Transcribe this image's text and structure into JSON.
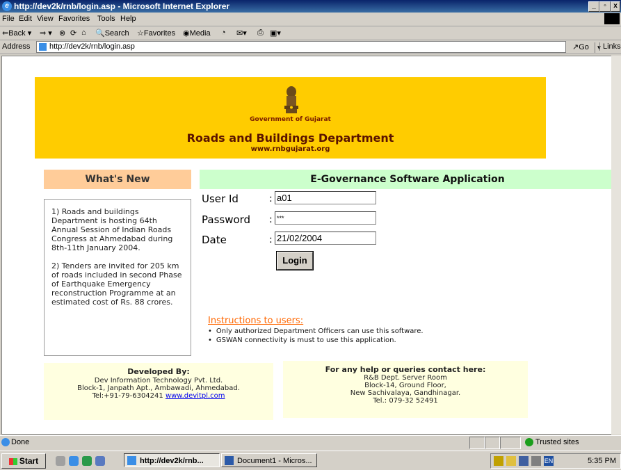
{
  "window": {
    "title": "http://dev2k/rnb/login.asp - Microsoft Internet Explorer"
  },
  "menu": [
    "File",
    "Edit",
    "View",
    "Favorites",
    "Tools",
    "Help"
  ],
  "toolbar": {
    "back": "⇐Back ▾",
    "forward": "⇒ ▾",
    "search": "Search",
    "favorites": "Favorites",
    "media": "Media"
  },
  "address": {
    "label": "Address",
    "url": "http://dev2k/rnb/login.asp",
    "go": "Go",
    "links": "Links"
  },
  "banner": {
    "gov": "Government of Gujarat",
    "dept": "Roads and Buildings Department",
    "www": "www.rnbgujarat.org"
  },
  "whats_new": {
    "heading": "What's New",
    "items": [
      "1) Roads and buildings Department is hosting 64th Annual Session of Indian Roads Congress at Ahmedabad during 8th-11th January 2004.",
      "2) Tenders are invited for 205 km of roads included in second Phase of Earthquake Emergency reconstruction Programme at an estimated cost of Rs. 88 crores."
    ]
  },
  "egov": {
    "heading": "E-Governance Software Application",
    "user_label": "User Id",
    "user_value": "a01",
    "password_label": "Password",
    "password_value": "***",
    "date_label": "Date",
    "date_value": "21/02/2004",
    "colon": ":",
    "login": "Login"
  },
  "instructions": {
    "title": "Instructions to users:",
    "items": [
      "Only authorized Department Officers can use this software.",
      "GSWAN connectivity is must to use this application."
    ]
  },
  "developer": {
    "title": "Developed By:",
    "line1": "Dev Information Technology Pvt. Ltd.",
    "line2": "Block-1, Janpath Apt., Ambawadi, Ahmedabad.",
    "tel": "Tel:+91-79-6304241",
    "site": "www.devitpl.com"
  },
  "help": {
    "title": "For any help or queries contact here:",
    "line1": "R&B Dept. Server Room",
    "line2": "Block-14, Ground Floor,",
    "line3": "New Sachivalaya, Gandhinagar.",
    "tel": "Tel.: 079-32 52491"
  },
  "status": {
    "text": "Done",
    "zone": "Trusted sites"
  },
  "taskbar": {
    "start": "Start",
    "task1": "http://dev2k/rnb...",
    "task2": "Document1 - Micros...",
    "clock": "5:35 PM",
    "lang": "EN"
  }
}
